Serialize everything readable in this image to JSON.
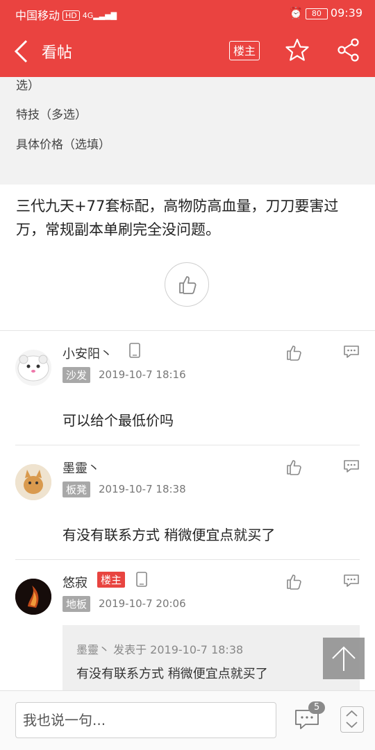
{
  "status_bar": {
    "carrier": "中国移动",
    "hd": "HD",
    "network": "4G",
    "battery": "80",
    "time": "09:39"
  },
  "header": {
    "title": "看帖",
    "owner_only_label": "楼主"
  },
  "info": {
    "line1": "选）",
    "line2": "特技（多选）",
    "line3": "具体价格（选填）"
  },
  "post": {
    "content": "三代九天+77套标配，高物防高血量，刀刀要害过万，常规副本单刷完全没问题。"
  },
  "replies": [
    {
      "username": "小安阳丶",
      "floor": "沙发",
      "time": "2019-10-7 18:16",
      "content": "可以给个最低价吗",
      "is_owner": false,
      "mobile": true
    },
    {
      "username": "墨靈丶",
      "floor": "板凳",
      "time": "2019-10-7 18:38",
      "content": "有没有联系方式 稍微便宜点就买了",
      "is_owner": false,
      "mobile": false
    },
    {
      "username": "悠寂",
      "owner_badge": "楼主",
      "floor": "地板",
      "time": "2019-10-7 20:06",
      "is_owner": true,
      "mobile": true,
      "quote": {
        "header": "墨靈丶 发表于 2019-10-7 18:38",
        "content": "有没有联系方式 稍微便宜点就买了"
      }
    }
  ],
  "bottom_bar": {
    "input_placeholder": "我也说一句...",
    "comment_count": "5"
  },
  "colors": {
    "brand_red": "#ea4340",
    "badge_grey": "#a8a8a8",
    "owner_badge_red": "#e84440"
  }
}
